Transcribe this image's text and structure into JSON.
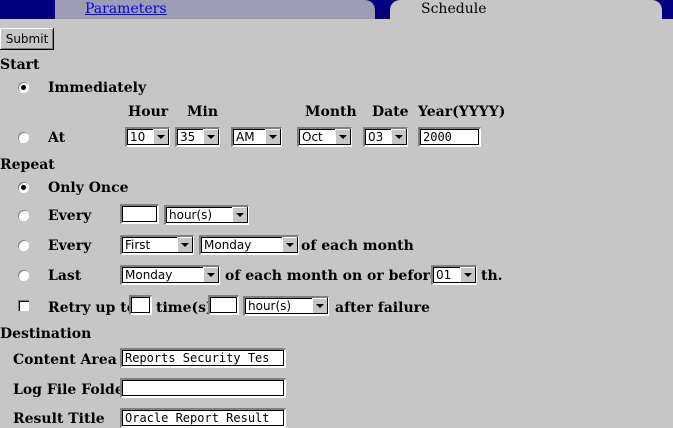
{
  "tabs": {
    "parameters": "Parameters",
    "schedule": "Schedule"
  },
  "submit": "Submit",
  "start": {
    "section": "Start",
    "immediately": "Immediately",
    "at": "At",
    "headers": {
      "hour": "Hour",
      "min": "Min",
      "month": "Month",
      "date": "Date",
      "year": "Year(YYYY)"
    },
    "hour": "10",
    "min": "35",
    "ampm": "AM",
    "month": "Oct",
    "date": "03",
    "year": "2000"
  },
  "repeat": {
    "section": "Repeat",
    "only_once": "Only Once",
    "every1": "Every",
    "every1_value": "",
    "every1_unit": "hour(s)",
    "every2": "Every",
    "every2_ordinal": "First",
    "every2_day": "Monday",
    "every2_suffix": "of each month",
    "last": "Last",
    "last_day": "Monday",
    "last_suffix": "of each month on or before the",
    "last_date": "01",
    "last_th": "th.",
    "retry_label": "Retry up to",
    "retry_count": "",
    "retry_times": "time(s)",
    "retry_interval": "",
    "retry_unit": "hour(s)",
    "retry_suffix": "after failure"
  },
  "destination": {
    "section": "Destination",
    "content_area_label": "Content Area",
    "content_area_value": "Reports Security Tes",
    "log_folder_label": "Log File Folder",
    "log_folder_value": "",
    "result_title_label": "Result Title",
    "result_title_value": "Oracle Report Result"
  }
}
